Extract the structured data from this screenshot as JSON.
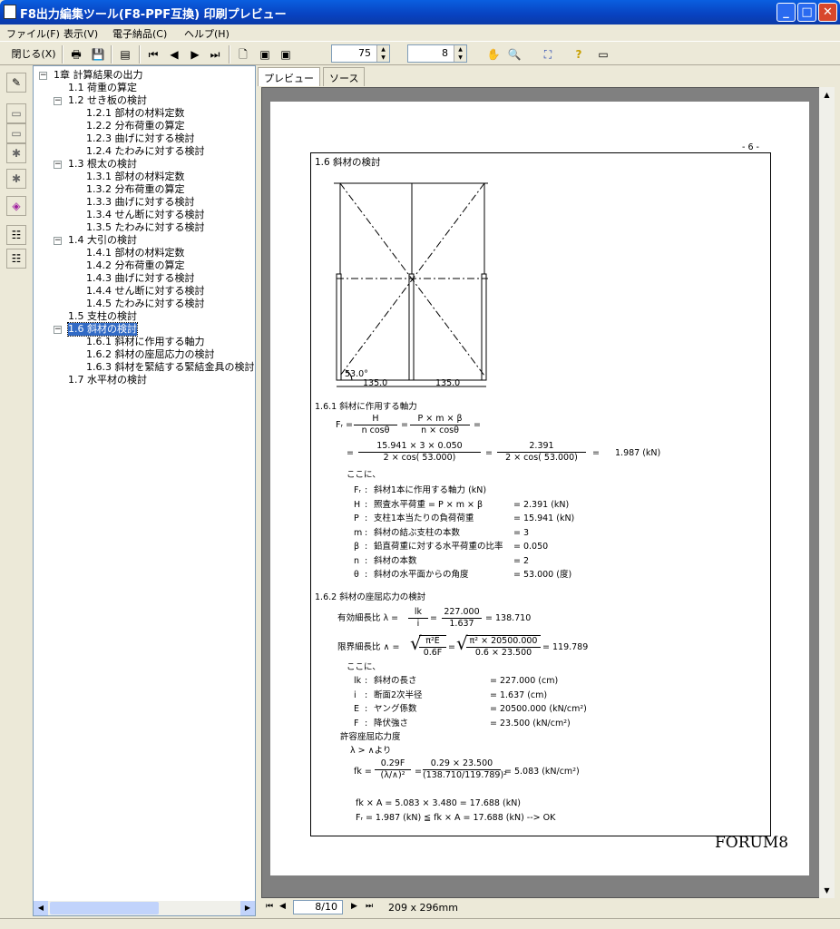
{
  "window": {
    "title": "F8出力編集ツール(F8-PPF互換) 印刷プレビュー"
  },
  "menu": [
    "ファイル(F)",
    "表示(V)",
    "電子納品(C)",
    "ヘルプ(H)"
  ],
  "toolbar": {
    "close_label": "閉じる(X)",
    "zoom_value": "75",
    "page_value": "8"
  },
  "tree": [
    {
      "label": "1章 計算結果の出力",
      "level": 0,
      "toggle": "−"
    },
    {
      "label": "1.1 荷重の算定",
      "level": 1
    },
    {
      "label": "1.2 せき板の検討",
      "level": 1,
      "toggle": "−"
    },
    {
      "label": "1.2.1 部材の材料定数",
      "level": 2
    },
    {
      "label": "1.2.2 分布荷重の算定",
      "level": 2
    },
    {
      "label": "1.2.3 曲げに対する検討",
      "level": 2
    },
    {
      "label": "1.2.4 たわみに対する検討",
      "level": 2
    },
    {
      "label": "1.3 根太の検討",
      "level": 1,
      "toggle": "−"
    },
    {
      "label": "1.3.1 部材の材料定数",
      "level": 2
    },
    {
      "label": "1.3.2 分布荷重の算定",
      "level": 2
    },
    {
      "label": "1.3.3 曲げに対する検討",
      "level": 2
    },
    {
      "label": "1.3.4 せん断に対する検討",
      "level": 2
    },
    {
      "label": "1.3.5 たわみに対する検討",
      "level": 2
    },
    {
      "label": "1.4 大引の検討",
      "level": 1,
      "toggle": "−"
    },
    {
      "label": "1.4.1 部材の材料定数",
      "level": 2
    },
    {
      "label": "1.4.2 分布荷重の算定",
      "level": 2
    },
    {
      "label": "1.4.3 曲げに対する検討",
      "level": 2
    },
    {
      "label": "1.4.4 せん断に対する検討",
      "level": 2
    },
    {
      "label": "1.4.5 たわみに対する検討",
      "level": 2
    },
    {
      "label": "1.5 支柱の検討",
      "level": 1
    },
    {
      "label": "1.6 斜材の検討",
      "level": 1,
      "toggle": "−",
      "selected": true
    },
    {
      "label": "1.6.1 斜材に作用する軸力",
      "level": 2
    },
    {
      "label": "1.6.2 斜材の座屈応力の検討",
      "level": 2
    },
    {
      "label": "1.6.3 斜材を緊結する緊結金具の検討",
      "level": 2
    },
    {
      "label": "1.7 水平材の検討",
      "level": 1
    }
  ],
  "tabs": [
    "プレビュー",
    "ソース"
  ],
  "page": {
    "page_number": "- 6 -",
    "logo": "FORUM8",
    "heading": "1.6 斜材の検討",
    "diagram": {
      "angle": "53.0°",
      "dim1": "135.0",
      "dim2": "135.0"
    },
    "s1": {
      "title": "1.6.1 斜材に作用する軸力",
      "fr": "Fᵣ =",
      "f1n": "H",
      "f1d": "n cosθ",
      "eq": "=",
      "f2n": "P × m × β",
      "f2d": "n × cosθ",
      "f3n": "15.941 ×   3 ×    0.050",
      "f3d": "2 × cos(   53.000)",
      "f4n": "2.391",
      "f4d": "2 × cos(   53.000)",
      "result": "1.987 (kN)",
      "koko": "ここに、",
      "defs": [
        {
          "sym": "Fᵣ",
          "desc": "斜材1本に作用する軸力 (kN)",
          "val": ""
        },
        {
          "sym": "H",
          "desc": "照査水平荷重 = P × m × β",
          "val": "=    2.391 (kN)"
        },
        {
          "sym": "P",
          "desc": "支柱1本当たりの負荷荷重",
          "val": "=   15.941 (kN)"
        },
        {
          "sym": "m",
          "desc": "斜材の結ぶ支柱の本数",
          "val": "= 3"
        },
        {
          "sym": "β",
          "desc": "鉛直荷重に対する水平荷重の比率",
          "val": "=    0.050"
        },
        {
          "sym": "n",
          "desc": "斜材の本数",
          "val": "= 2"
        },
        {
          "sym": "θ",
          "desc": "斜材の水平面からの角度",
          "val": "=   53.000 (度)"
        }
      ]
    },
    "s2": {
      "title": "1.6.2 斜材の座屈応力の検討",
      "l1": "有効細長比  λ =",
      "l1n": "lk",
      "l1d": "i",
      "l2n": "227.000",
      "l2d": "1.637",
      "l1r": "=  138.710",
      "k1": "限界細長比  ∧ =",
      "k1n": "π²E",
      "k1d": "0.6F",
      "k2n": "π² × 20500.000",
      "k2d": "0.6 ×    23.500",
      "k1r": "=  119.789",
      "koko": "ここに、",
      "defs": [
        {
          "sym": "lk",
          "desc": "斜材の長さ",
          "val": "=  227.000 (cm)"
        },
        {
          "sym": "i",
          "desc": "断面2次半径",
          "val": "=    1.637 (cm)"
        },
        {
          "sym": "E",
          "desc": "ヤング係数",
          "val": "= 20500.000 (kN/cm²)"
        },
        {
          "sym": "F",
          "desc": "降伏強さ",
          "val": "=   23.500 (kN/cm²)"
        }
      ],
      "allow": "許容座屈応力度",
      "cond": "λ > ∧より",
      "fk": "fk =",
      "fk1n": "0.29F",
      "fk1d": "(λ/∧)²",
      "fk2n": "0.29  ×    23.500",
      "fk2d": "(138.710/119.789)²",
      "fkr": "=     5.083 (kN/cm²)",
      "fkA": "fk × A =     5.083 ×     3.480 =    17.688 (kN)",
      "check": "Fᵣ =     1.987 (kN) ≦ fk × A =    17.688 (kN) --> OK"
    }
  },
  "nav": {
    "page": "8/10",
    "size": "209 x 296mm"
  }
}
